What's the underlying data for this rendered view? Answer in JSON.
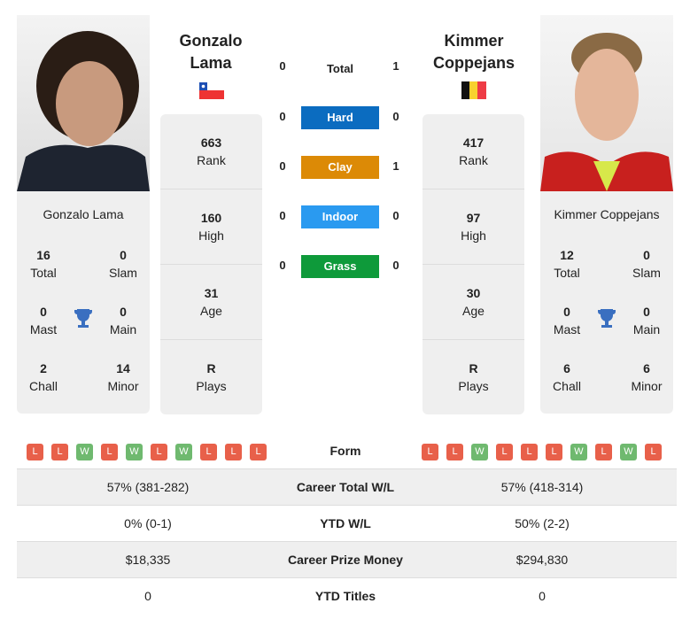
{
  "player1": {
    "name_line1": "Gonzalo",
    "name_line2": "Lama",
    "full_name": "Gonzalo Lama",
    "country": "Chile",
    "total": "16",
    "total_label": "Total",
    "slam": "0",
    "slam_label": "Slam",
    "mast": "0",
    "mast_label": "Mast",
    "main": "0",
    "main_label": "Main",
    "chall": "2",
    "chall_label": "Chall",
    "minor": "14",
    "minor_label": "Minor",
    "rank": "663",
    "rank_label": "Rank",
    "high": "160",
    "high_label": "High",
    "age": "31",
    "age_label": "Age",
    "plays": "R",
    "plays_label": "Plays",
    "form": [
      "L",
      "L",
      "W",
      "L",
      "W",
      "L",
      "W",
      "L",
      "L",
      "L"
    ],
    "career_wl": "57% (381-282)",
    "ytd_wl": "0% (0-1)",
    "prize": "$18,335",
    "ytd_titles": "0"
  },
  "player2": {
    "name_line1": "Kimmer",
    "name_line2": "Coppejans",
    "full_name": "Kimmer Coppejans",
    "country": "Belgium",
    "total": "12",
    "total_label": "Total",
    "slam": "0",
    "slam_label": "Slam",
    "mast": "0",
    "mast_label": "Mast",
    "main": "0",
    "main_label": "Main",
    "chall": "6",
    "chall_label": "Chall",
    "minor": "6",
    "minor_label": "Minor",
    "rank": "417",
    "rank_label": "Rank",
    "high": "97",
    "high_label": "High",
    "age": "30",
    "age_label": "Age",
    "plays": "R",
    "plays_label": "Plays",
    "form": [
      "L",
      "L",
      "W",
      "L",
      "L",
      "L",
      "W",
      "L",
      "W",
      "L"
    ],
    "career_wl": "57% (418-314)",
    "ytd_wl": "50% (2-2)",
    "prize": "$294,830",
    "ytd_titles": "0"
  },
  "h2h": {
    "total_label": "Total",
    "total": [
      "0",
      "1"
    ],
    "surfaces": [
      {
        "label": "Hard",
        "p1": "0",
        "p2": "0",
        "color": "#0b6cc0"
      },
      {
        "label": "Clay",
        "p1": "0",
        "p2": "1",
        "color": "#dc8a06"
      },
      {
        "label": "Indoor",
        "p1": "0",
        "p2": "0",
        "color": "#2a9af0"
      },
      {
        "label": "Grass",
        "p1": "0",
        "p2": "0",
        "color": "#0e9a3a"
      }
    ]
  },
  "table": {
    "form_label": "Form",
    "career_label": "Career Total W/L",
    "ytd_label": "YTD W/L",
    "prize_label": "Career Prize Money",
    "titles_label": "YTD Titles"
  },
  "icons": {
    "trophy": "trophy-icon"
  },
  "colors": {
    "win": "#6fb96f",
    "loss": "#e8604a",
    "trophy": "#3a6fc0"
  }
}
